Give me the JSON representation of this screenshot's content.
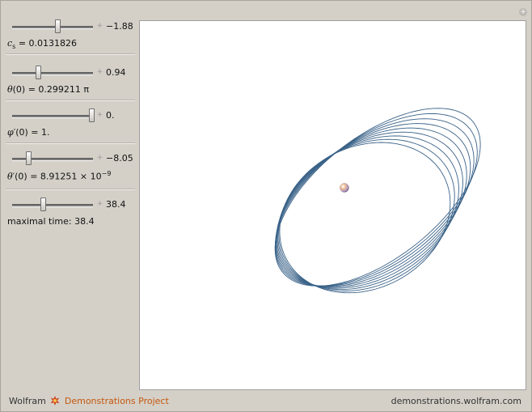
{
  "controls": [
    {
      "value": "−1.88",
      "fraction": 0.56,
      "label_symbol": "c",
      "label_sub": "s",
      "label_rest": " = 0.0131826"
    },
    {
      "value": "0.94",
      "fraction": 0.32,
      "label_symbol": "θ",
      "label_sub": "",
      "label_rest": "(0) = 0.299211 π"
    },
    {
      "value": "0.",
      "fraction": 0.98,
      "label_symbol": "φ",
      "label_sub": "",
      "label_rest": "′(0) = 1."
    },
    {
      "value": "−8.05",
      "fraction": 0.2,
      "label_symbol": "θ",
      "label_sub": "",
      "label_rest": "′(0) = 8.91251 × 10",
      "label_sup": "−9"
    },
    {
      "value": "38.4",
      "fraction": 0.38,
      "label_symbol": "",
      "label_sub": "",
      "label_rest": "maximal time: 38.4"
    }
  ],
  "footer": {
    "brand_left": "Wolfram",
    "brand_right": "Demonstrations Project",
    "site": "demonstrations.wolfram.com"
  },
  "colors": {
    "curve": "#3a6288",
    "accent": "#c4570c"
  },
  "icons": {
    "corner": "plus-circle-icon",
    "slider_step": "plus-small-icon",
    "brand": "wolfram-spikey-icon"
  }
}
